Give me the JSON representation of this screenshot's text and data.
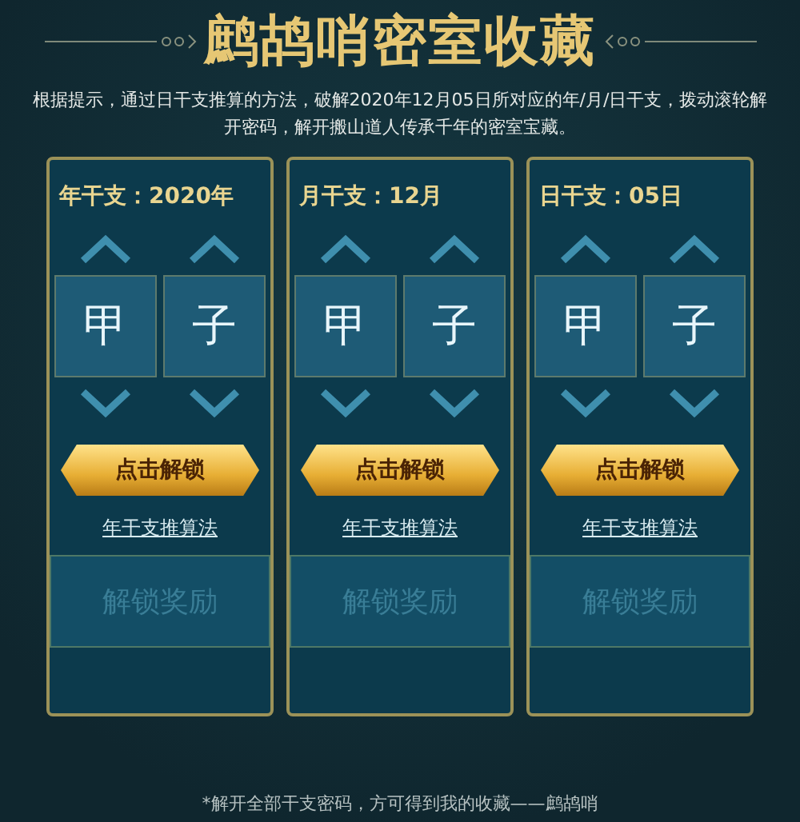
{
  "title": "鹧鸪哨密室收藏",
  "description": "根据提示，通过日干支推算的方法，破解2020年12月05日所对应的年/月/日干支，拨动滚轮解开密码，解开搬山道人传承千年的密室宝藏。",
  "cards": [
    {
      "label": "年干支：2020年",
      "dials": [
        {
          "value": "甲"
        },
        {
          "value": "子"
        }
      ],
      "unlock_button": "点击解锁",
      "hint_link": "年干支推算法",
      "reward": "解锁奖励"
    },
    {
      "label": "月干支：12月",
      "dials": [
        {
          "value": "甲"
        },
        {
          "value": "子"
        }
      ],
      "unlock_button": "点击解锁",
      "hint_link": "年干支推算法",
      "reward": "解锁奖励"
    },
    {
      "label": "日干支：05日",
      "dials": [
        {
          "value": "甲"
        },
        {
          "value": "子"
        }
      ],
      "unlock_button": "点击解锁",
      "hint_link": "年干支推算法",
      "reward": "解锁奖励"
    }
  ],
  "footer": "*解开全部干支密码，方可得到我的收藏——鹧鸪哨"
}
